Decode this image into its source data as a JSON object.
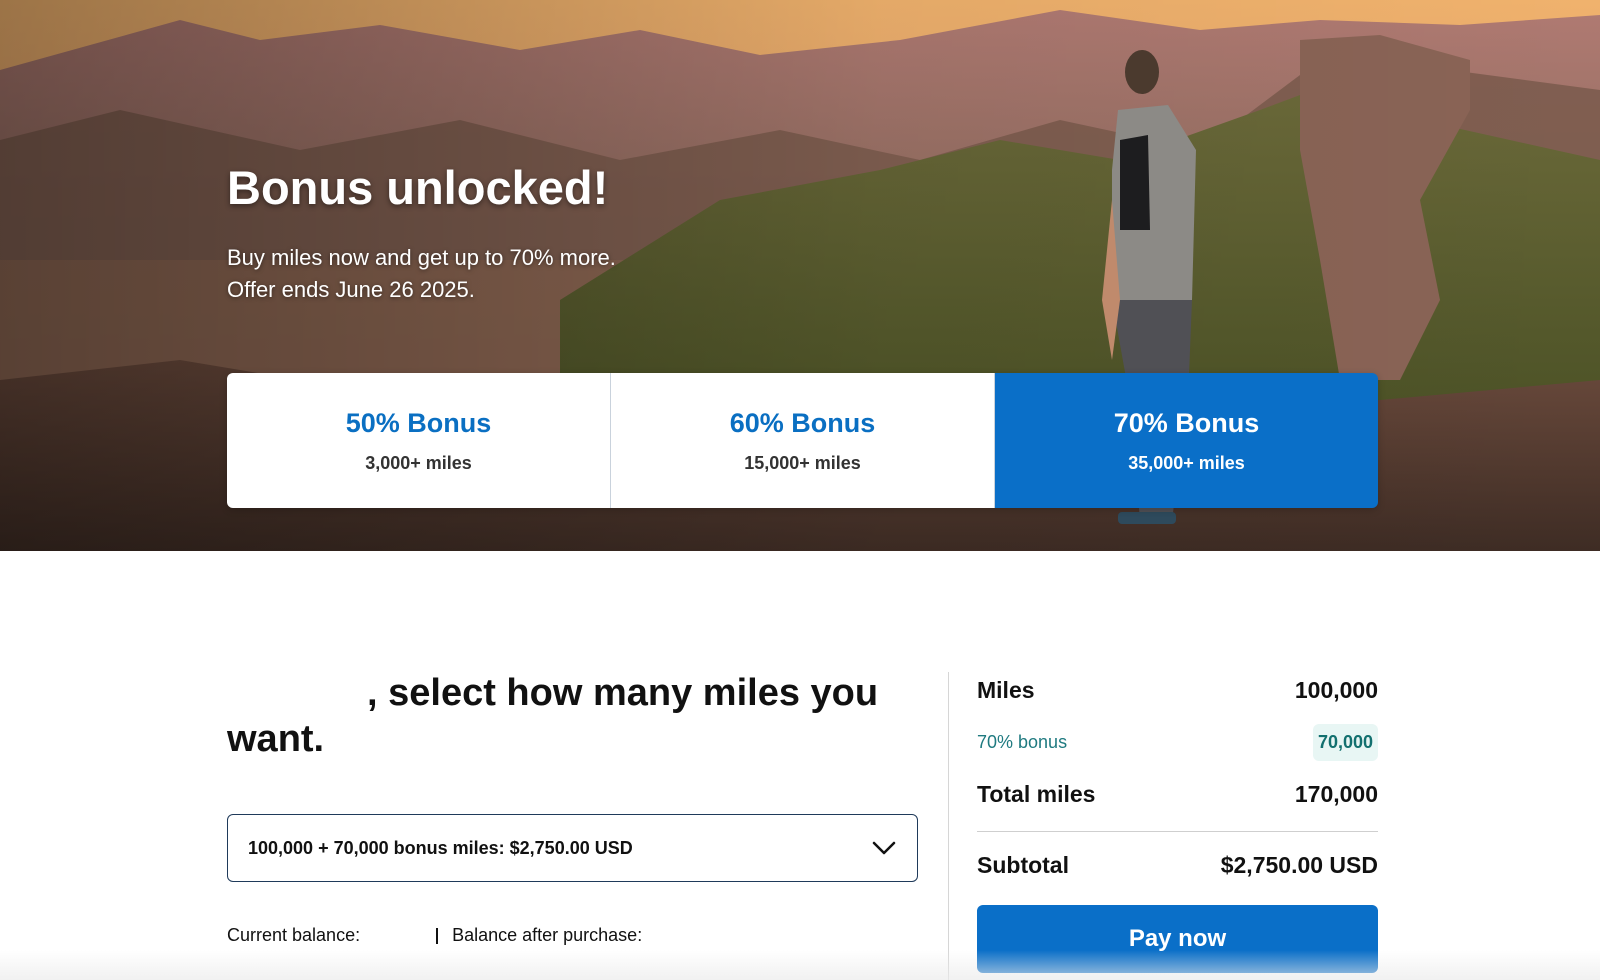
{
  "hero": {
    "title": "Bonus unlocked!",
    "subtitle_line1": "Buy miles now and get up to 70% more.",
    "subtitle_line2": "Offer ends June 26 2025."
  },
  "tiers": [
    {
      "name": "50% Bonus",
      "minimum": "3,000+ miles",
      "selected": false
    },
    {
      "name": "60% Bonus",
      "minimum": "15,000+ miles",
      "selected": false
    },
    {
      "name": "70% Bonus",
      "minimum": "35,000+ miles",
      "selected": true
    }
  ],
  "purchase": {
    "heading": ", select how many miles you want.",
    "selected_option": "100,000 + 70,000 bonus miles: $2,750.00 USD",
    "current_balance_label": "Current balance:",
    "balance_after_label": "Balance after purchase:"
  },
  "summary": {
    "miles_label": "Miles",
    "miles_value": "100,000",
    "bonus_label": "70% bonus",
    "bonus_value": "70,000",
    "total_label": "Total miles",
    "total_value": "170,000",
    "subtotal_label": "Subtotal",
    "subtotal_value": "$2,750.00 USD",
    "pay_button": "Pay now"
  },
  "colors": {
    "accent": "#0a6fc8",
    "bonus_text": "#1f7a80",
    "bonus_bg": "#e8f6f4"
  },
  "icons": {
    "dropdown": "chevron-down-icon"
  }
}
